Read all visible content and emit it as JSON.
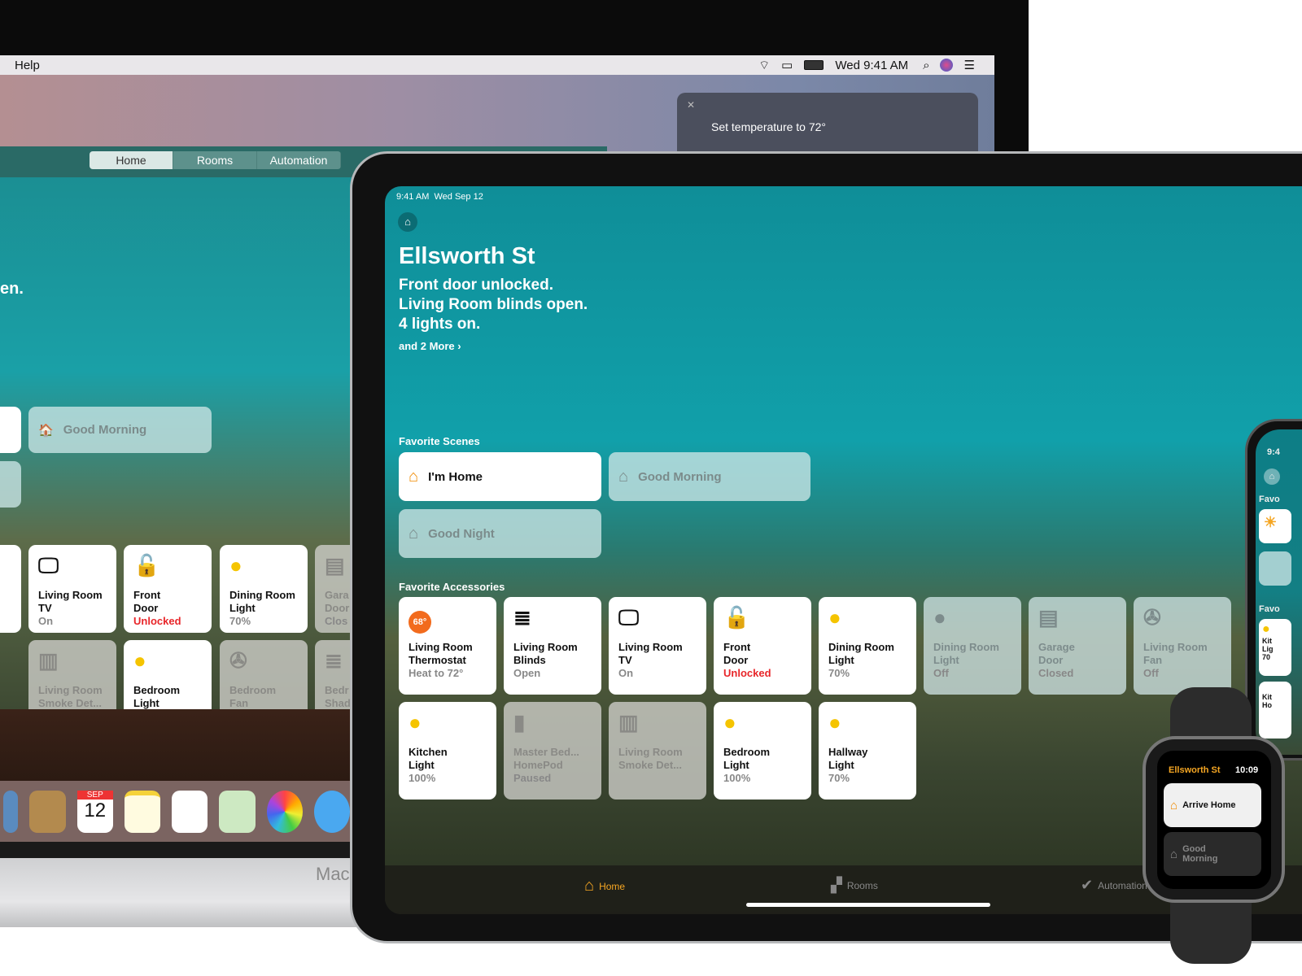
{
  "mac": {
    "menubar": {
      "menu": "Help",
      "clock": "Wed 9:41 AM",
      "icons": [
        "wifi-icon",
        "airplay-icon",
        "battery-icon",
        "search-icon",
        "siri-icon",
        "notification-list-icon"
      ]
    },
    "siri": {
      "text": "Set temperature to 72°"
    },
    "tabs": [
      {
        "label": "Home",
        "active": true
      },
      {
        "label": "Rooms"
      },
      {
        "label": "Automation"
      }
    ],
    "status_fragment": "en.",
    "scenes": [
      {
        "label": "Good Morning",
        "active": false
      }
    ],
    "tiles_row1": [
      {
        "name": "Living Room\nTV",
        "status": "On",
        "icon": "tv-icon"
      },
      {
        "name": "Front\nDoor",
        "status": "Unlocked",
        "icon": "lock-open-icon",
        "alert": true
      },
      {
        "name": "Dining Room\nLight",
        "status": "70%",
        "icon": "lightbulb-icon"
      },
      {
        "name": "Gara\nDoor",
        "status": "Clos",
        "icon": "garage-icon",
        "off": true
      }
    ],
    "tiles_row2": [
      {
        "name": "Living Room\nSmoke Det...",
        "status": "",
        "icon": "smoke-detector-icon",
        "off": true
      },
      {
        "name": "Bedroom\nLight",
        "status": "",
        "icon": "lightbulb-icon"
      },
      {
        "name": "Bedroom\nFan",
        "status": "",
        "icon": "fan-icon",
        "off": true
      },
      {
        "name": "Bedr\nShad",
        "status": "",
        "icon": "blinds-icon",
        "off": true
      }
    ],
    "dock": {
      "calendar_month": "SEP",
      "calendar_day": "12"
    },
    "label": "Mac"
  },
  "ipad": {
    "status_time": "9:41 AM  Wed Sep 12",
    "home_title": "Ellsworth St",
    "summary": [
      "Front door unlocked.",
      "Living Room blinds open.",
      "4 lights on."
    ],
    "more_link": "and 2 More ›",
    "scenes_header": "Favorite Scenes",
    "scenes": [
      {
        "label": "I'm Home",
        "active": true
      },
      {
        "label": "Good Morning",
        "active": false
      },
      {
        "label": "Good Night",
        "active": false
      }
    ],
    "accessories_header": "Favorite Accessories",
    "accessories": [
      {
        "name": "Living Room\nThermostat",
        "status": "Heat to 72°",
        "badge": "68°",
        "state": "on"
      },
      {
        "name": "Living Room\nBlinds",
        "status": "Open",
        "icon": "blinds-icon",
        "state": "on"
      },
      {
        "name": "Living Room\nTV",
        "status": "On",
        "icon": "tv-icon",
        "state": "on"
      },
      {
        "name": "Front\nDoor",
        "status": "Unlocked",
        "icon": "lock-open-icon",
        "state": "on",
        "alert": true
      },
      {
        "name": "Dining Room\nLight",
        "status": "70%",
        "icon": "lightbulb-icon",
        "state": "on"
      },
      {
        "name": "Dining Room\nLight",
        "status": "Off",
        "icon": "lightbulb-icon",
        "state": "off"
      },
      {
        "name": "Garage\nDoor",
        "status": "Closed",
        "icon": "garage-icon",
        "state": "off"
      },
      {
        "name": "Living Room\nFan",
        "status": "Off",
        "icon": "fan-icon",
        "state": "off"
      },
      {
        "name": "Kitchen\nLight",
        "status": "100%",
        "icon": "lightbulb-icon",
        "state": "on"
      },
      {
        "name": "Master Bed...\nHomePod",
        "status": "Paused",
        "icon": "homepod-icon",
        "state": "dim"
      },
      {
        "name": "Living Room\nSmoke Det...",
        "status": "",
        "icon": "smoke-detector-icon",
        "state": "dim"
      },
      {
        "name": "Bedroom\nLight",
        "status": "100%",
        "icon": "lightbulb-icon",
        "state": "on"
      },
      {
        "name": "Hallway\nLight",
        "status": "70%",
        "icon": "lightbulb-icon",
        "state": "on"
      }
    ],
    "tabbar": [
      {
        "label": "Home",
        "active": true
      },
      {
        "label": "Rooms"
      },
      {
        "label": "Automation"
      }
    ],
    "accent": "#f5a623"
  },
  "iphone": {
    "time": "9:4",
    "section1": "Favo",
    "section2": "Favo",
    "tile1": "Kit\nLig\n70",
    "tile2": "Kit\nHo"
  },
  "watch": {
    "home": "Ellsworth St",
    "time": "10:09",
    "scenes": [
      {
        "label": "Arrive Home",
        "active": true
      },
      {
        "label": "Good\nMorning",
        "active": false
      }
    ]
  }
}
